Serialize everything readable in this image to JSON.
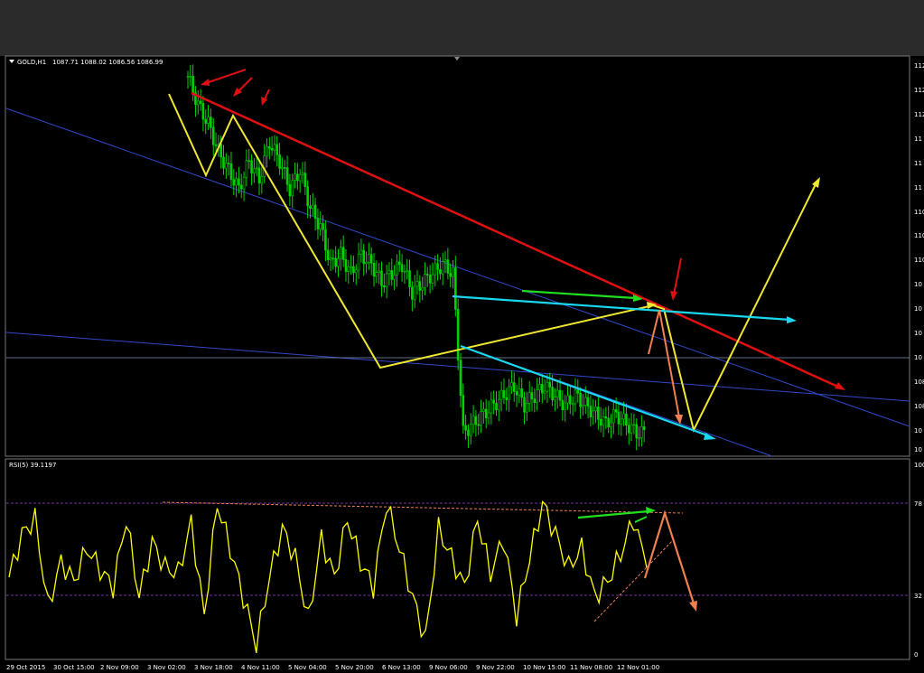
{
  "header": {
    "symbol": "GOLD,H1",
    "ohlc": "1087.71 1088.02 1086.56 1086.99"
  },
  "indicator": {
    "label": "RSI(5) 39.1197",
    "levels": [
      "100",
      "78",
      "32",
      "0"
    ]
  },
  "time_axis": [
    "29 Oct 2015",
    "30 Oct 15:00",
    "2 Nov 09:00",
    "3 Nov 02:00",
    "3 Nov 18:00",
    "4 Nov 11:00",
    "5 Nov 04:00",
    "5 Nov 20:00",
    "6 Nov 13:00",
    "9 Nov 06:00",
    "9 Nov 22:00",
    "10 Nov 15:00",
    "11 Nov 08:00",
    "12 Nov 01:00"
  ],
  "price_axis": [
    "112",
    "112",
    "112",
    "11",
    "11",
    "11",
    "110",
    "110",
    "110",
    "10",
    "10",
    "10",
    "10",
    "108",
    "108",
    "10",
    "10"
  ],
  "colors": {
    "background": "#000000",
    "candles": "#00d200",
    "rsi": "#ffff00",
    "trend_red": "#e01010",
    "channel_cyan": "#18d8f0",
    "zigzag_yellow": "#f0e830",
    "channel_blue": "#3048c8",
    "green_arrow": "#20e020",
    "orange_arrow": "#f08050",
    "level_line": "#7030a0"
  },
  "chart_data": [
    {
      "type": "candlestick",
      "title": "GOLD,H1",
      "series": [
        {
          "name": "GOLD,H1",
          "values": [
            1124,
            1121,
            1119,
            1116,
            1114,
            1112,
            1115,
            1113,
            1117,
            1115,
            1112,
            1114,
            1110,
            1108,
            1104,
            1105,
            1103,
            1105,
            1104,
            1102,
            1103,
            1104,
            1101,
            1102,
            1103,
            1104,
            1103,
            1086,
            1087,
            1088,
            1089,
            1090,
            1091,
            1089,
            1090,
            1091,
            1090,
            1089,
            1090,
            1089,
            1088,
            1087,
            1088,
            1087,
            1086
          ]
        }
      ],
      "last_price": 1086.99
    },
    {
      "type": "line",
      "series": [
        {
          "name": "RSI(5)",
          "values": [
            40,
            62,
            70,
            25,
            48,
            38,
            55,
            44,
            35,
            70,
            30,
            58,
            45,
            42,
            68,
            20,
            78,
            55,
            30,
            5,
            40,
            65,
            50,
            18,
            60,
            40,
            70,
            48,
            35,
            78,
            55,
            30,
            8,
            65,
            50,
            35,
            70,
            42,
            60,
            20,
            50,
            78,
            62,
            45,
            55,
            30,
            38,
            52,
            70,
            45
          ]
        }
      ],
      "levels": [
        78,
        32
      ],
      "ylim": [
        0,
        100
      ],
      "last_value": 39.1197
    }
  ]
}
